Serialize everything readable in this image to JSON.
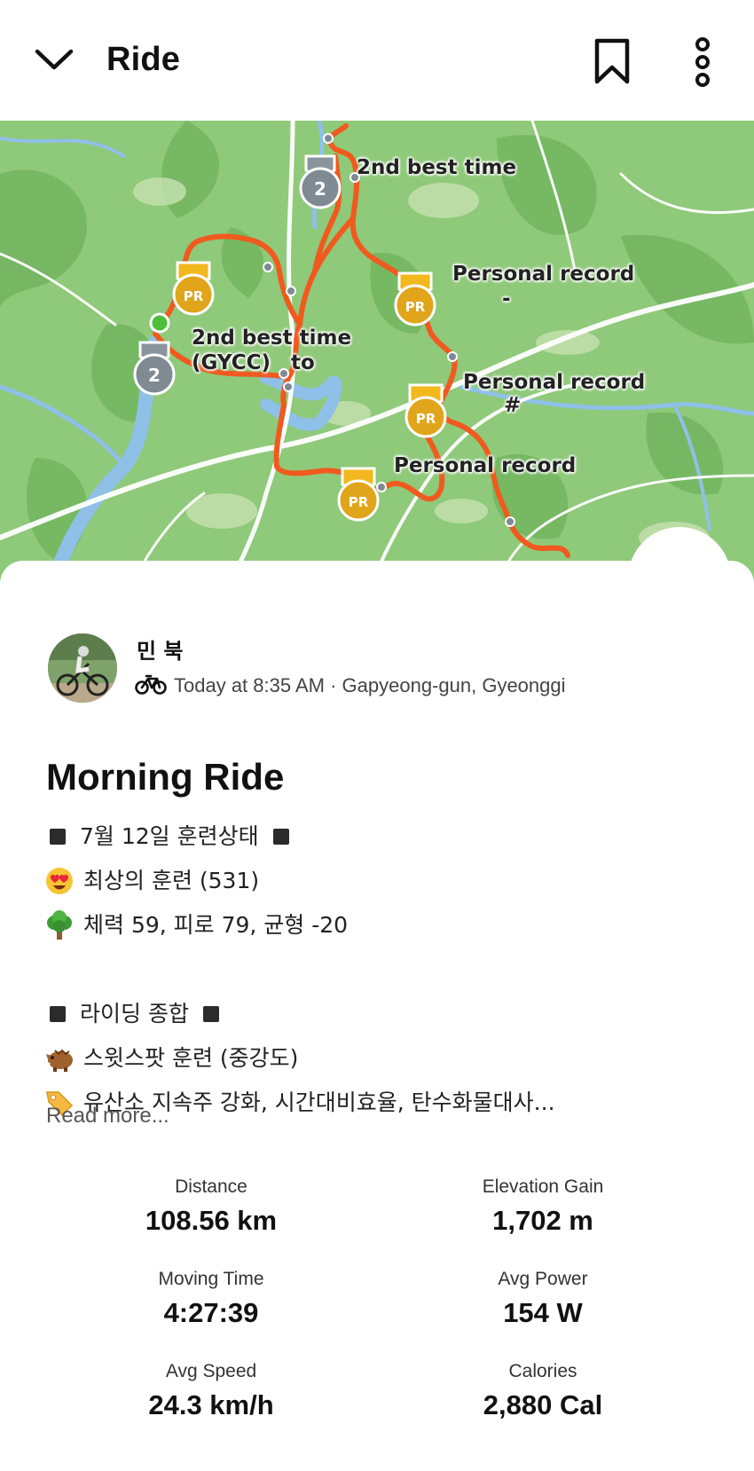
{
  "header": {
    "title": "Ride",
    "back_icon": "chevron-down-icon",
    "bookmark_icon": "bookmark-icon",
    "more_icon": "more-vertical-icon"
  },
  "map": {
    "labels": [
      {
        "key": "seg1",
        "text": "2nd best time"
      },
      {
        "key": "seg2",
        "text": "Personal record"
      },
      {
        "key": "seg2_sub",
        "text": "-"
      },
      {
        "key": "seg3a",
        "text": "2nd best time"
      },
      {
        "key": "seg3b",
        "text": "(GYCC)"
      },
      {
        "key": "seg3c",
        "text": "to"
      },
      {
        "key": "seg4",
        "text": "Personal record"
      },
      {
        "key": "seg4_sub",
        "text": "#"
      },
      {
        "key": "seg5",
        "text": "Personal record"
      }
    ],
    "medals": [
      {
        "kind": "2nd",
        "text": "2"
      },
      {
        "kind": "pr",
        "text": "PR"
      },
      {
        "kind": "pr",
        "text": "PR"
      },
      {
        "kind": "2nd",
        "text": "2"
      },
      {
        "kind": "pr",
        "text": "PR"
      },
      {
        "kind": "pr",
        "text": "PR"
      }
    ],
    "route_color": "#f05a1e",
    "terrain_color": "#8fc97a",
    "water_color": "#8ec0e8"
  },
  "athlete": {
    "name": "민 북",
    "sport_icon": "bike-icon",
    "meta": "Today at 8:35 AM · Gapyeong-gun, Gyeonggi"
  },
  "activity": {
    "title": "Morning Ride",
    "description": [
      "7월 12일 훈련상태",
      "최상의 훈련 (531)",
      "체력 59, 피로 79, 균형 -20",
      "",
      "라이딩 종합",
      "스윗스팟 훈련 (중강도)",
      "유산소 지속주 강화, 시간대비효율, 탄수화물대사..."
    ],
    "read_more": "Read more..."
  },
  "stats": [
    {
      "label": "Distance",
      "value": "108.56 km"
    },
    {
      "label": "Elevation Gain",
      "value": "1,702 m"
    },
    {
      "label": "Moving Time",
      "value": "4:27:39"
    },
    {
      "label": "Avg Power",
      "value": "154 W"
    },
    {
      "label": "Avg Speed",
      "value": "24.3 km/h"
    },
    {
      "label": "Calories",
      "value": "2,880 Cal"
    }
  ]
}
